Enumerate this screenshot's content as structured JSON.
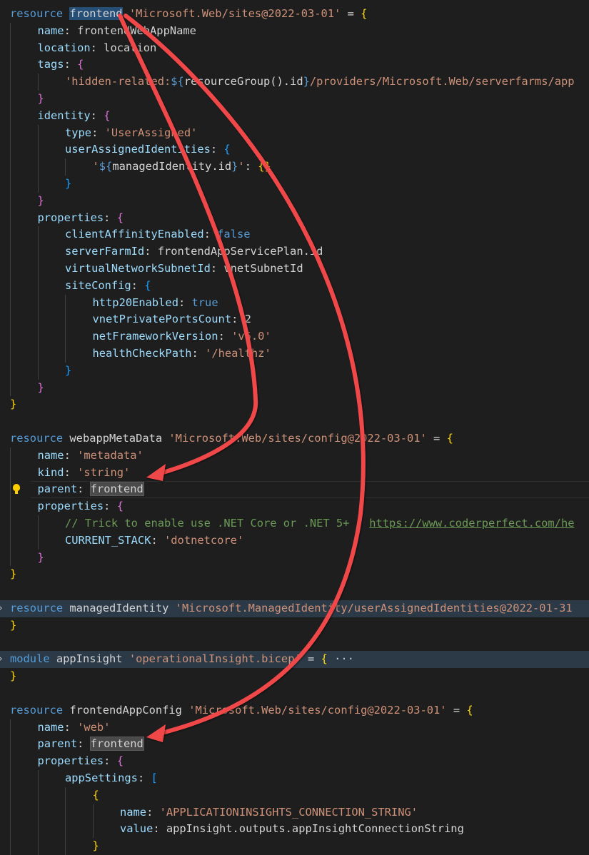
{
  "editor": {
    "lines": [
      {
        "segments": [
          {
            "t": "resource",
            "c": "k"
          },
          {
            "t": " "
          },
          {
            "t": "frontend",
            "c": "sel"
          },
          {
            "t": " "
          },
          {
            "t": "'Microsoft.Web/sites@2022-03-01'",
            "c": "s"
          },
          {
            "t": " = "
          },
          {
            "t": "{",
            "c": "b1"
          }
        ]
      },
      {
        "indent": 1,
        "segments": [
          {
            "t": "name",
            "c": "p"
          },
          {
            "t": ": frontendWebAppName"
          }
        ]
      },
      {
        "indent": 1,
        "segments": [
          {
            "t": "location",
            "c": "p"
          },
          {
            "t": ": location"
          }
        ]
      },
      {
        "indent": 1,
        "segments": [
          {
            "t": "tags",
            "c": "p"
          },
          {
            "t": ": "
          },
          {
            "t": "{",
            "c": "b2"
          }
        ]
      },
      {
        "indent": 2,
        "segments": [
          {
            "t": "'hidden-related:",
            "c": "s"
          },
          {
            "t": "${",
            "c": "k"
          },
          {
            "t": "resourceGroup().id"
          },
          {
            "t": "}",
            "c": "k"
          },
          {
            "t": "/providers/Microsoft.Web/serverfarms/app",
            "c": "s"
          }
        ]
      },
      {
        "indent": 1,
        "segments": [
          {
            "t": "}",
            "c": "b2"
          }
        ]
      },
      {
        "indent": 1,
        "segments": [
          {
            "t": "identity",
            "c": "p"
          },
          {
            "t": ": "
          },
          {
            "t": "{",
            "c": "b2"
          }
        ]
      },
      {
        "indent": 2,
        "segments": [
          {
            "t": "type",
            "c": "p"
          },
          {
            "t": ": "
          },
          {
            "t": "'UserAssigned'",
            "c": "s"
          }
        ]
      },
      {
        "indent": 2,
        "segments": [
          {
            "t": "userAssignedIdentities",
            "c": "p"
          },
          {
            "t": ": "
          },
          {
            "t": "{",
            "c": "b3"
          }
        ]
      },
      {
        "indent": 3,
        "segments": [
          {
            "t": "'",
            "c": "s"
          },
          {
            "t": "${",
            "c": "k"
          },
          {
            "t": "managedIdentity.id"
          },
          {
            "t": "}",
            "c": "k"
          },
          {
            "t": "'",
            "c": "s"
          },
          {
            "t": ": "
          },
          {
            "t": "{}",
            "c": "b1"
          }
        ]
      },
      {
        "indent": 2,
        "segments": [
          {
            "t": "}",
            "c": "b3"
          }
        ]
      },
      {
        "indent": 1,
        "segments": [
          {
            "t": "}",
            "c": "b2"
          }
        ]
      },
      {
        "indent": 1,
        "segments": [
          {
            "t": "properties",
            "c": "p"
          },
          {
            "t": ": "
          },
          {
            "t": "{",
            "c": "b2"
          }
        ]
      },
      {
        "indent": 2,
        "segments": [
          {
            "t": "clientAffinityEnabled",
            "c": "p"
          },
          {
            "t": ": "
          },
          {
            "t": "false",
            "c": "k"
          }
        ]
      },
      {
        "indent": 2,
        "segments": [
          {
            "t": "serverFarmId",
            "c": "p"
          },
          {
            "t": ": frontendAppServicePlan.id"
          }
        ]
      },
      {
        "indent": 2,
        "segments": [
          {
            "t": "virtualNetworkSubnetId",
            "c": "p"
          },
          {
            "t": ": vnetSubnetId"
          }
        ]
      },
      {
        "indent": 2,
        "segments": [
          {
            "t": "siteConfig",
            "c": "p"
          },
          {
            "t": ": "
          },
          {
            "t": "{",
            "c": "b3"
          }
        ]
      },
      {
        "indent": 3,
        "segments": [
          {
            "t": "http20Enabled",
            "c": "p"
          },
          {
            "t": ": "
          },
          {
            "t": "true",
            "c": "k"
          }
        ]
      },
      {
        "indent": 3,
        "segments": [
          {
            "t": "vnetPrivatePortsCount",
            "c": "p"
          },
          {
            "t": ": 2"
          }
        ]
      },
      {
        "indent": 3,
        "segments": [
          {
            "t": "netFrameworkVersion",
            "c": "p"
          },
          {
            "t": ": "
          },
          {
            "t": "'v6.0'",
            "c": "s"
          }
        ]
      },
      {
        "indent": 3,
        "segments": [
          {
            "t": "healthCheckPath",
            "c": "p"
          },
          {
            "t": ": "
          },
          {
            "t": "'/healthz'",
            "c": "s"
          }
        ]
      },
      {
        "indent": 2,
        "segments": [
          {
            "t": "}",
            "c": "b3"
          }
        ]
      },
      {
        "indent": 1,
        "segments": [
          {
            "t": "}",
            "c": "b2"
          }
        ]
      },
      {
        "segments": [
          {
            "t": "}",
            "c": "b1"
          }
        ]
      },
      {
        "segments": []
      },
      {
        "segments": [
          {
            "t": "resource",
            "c": "k"
          },
          {
            "t": " webappMetaData "
          },
          {
            "t": "'Microsoft.Web/sites/config@2022-03-01'",
            "c": "s"
          },
          {
            "t": " = "
          },
          {
            "t": "{",
            "c": "b1"
          }
        ]
      },
      {
        "indent": 1,
        "segments": [
          {
            "t": "name",
            "c": "p"
          },
          {
            "t": ": "
          },
          {
            "t": "'metadata'",
            "c": "s"
          }
        ]
      },
      {
        "indent": 1,
        "segments": [
          {
            "t": "kind",
            "c": "p"
          },
          {
            "t": ": "
          },
          {
            "t": "'string'",
            "c": "s"
          }
        ]
      },
      {
        "indent": 1,
        "cursor": true,
        "bulb": true,
        "segments": [
          {
            "t": "parent",
            "c": "p"
          },
          {
            "t": ": "
          },
          {
            "t": "frontend",
            "c": "hl"
          }
        ]
      },
      {
        "indent": 1,
        "segments": [
          {
            "t": "properties",
            "c": "p"
          },
          {
            "t": ": "
          },
          {
            "t": "{",
            "c": "b2"
          }
        ]
      },
      {
        "indent": 2,
        "segments": [
          {
            "t": "// Trick to enable use .NET Core or .NET 5+ : ",
            "c": "c"
          },
          {
            "t": "https://www.coderperfect.com/he",
            "c": "u"
          }
        ]
      },
      {
        "indent": 2,
        "segments": [
          {
            "t": "CURRENT_STACK",
            "c": "p"
          },
          {
            "t": ": "
          },
          {
            "t": "'dotnetcore'",
            "c": "s"
          }
        ]
      },
      {
        "indent": 1,
        "segments": [
          {
            "t": "}",
            "c": "b2"
          }
        ]
      },
      {
        "segments": [
          {
            "t": "}",
            "c": "b1"
          }
        ]
      },
      {
        "segments": []
      },
      {
        "folded": true,
        "segments": [
          {
            "t": "resource",
            "c": "k"
          },
          {
            "t": " managedIdentity "
          },
          {
            "t": "'Microsoft.ManagedIdentity/userAssignedIdentities@2022-01-31",
            "c": "s"
          }
        ]
      },
      {
        "segments": [
          {
            "t": "}",
            "c": "b1"
          }
        ]
      },
      {
        "segments": []
      },
      {
        "folded": true,
        "segments": [
          {
            "t": "module",
            "c": "k"
          },
          {
            "t": " appInsight "
          },
          {
            "t": "'operationalInsight.bicep'",
            "c": "s"
          },
          {
            "t": " = "
          },
          {
            "t": "{",
            "c": "b1"
          },
          {
            "t": " ···",
            "c": "ell"
          }
        ]
      },
      {
        "segments": [
          {
            "t": "}",
            "c": "b1"
          }
        ]
      },
      {
        "segments": []
      },
      {
        "segments": [
          {
            "t": "resource",
            "c": "k"
          },
          {
            "t": " frontendAppConfig "
          },
          {
            "t": "'Microsoft.Web/sites/config@2022-03-01'",
            "c": "s"
          },
          {
            "t": " = "
          },
          {
            "t": "{",
            "c": "b1"
          }
        ]
      },
      {
        "indent": 1,
        "segments": [
          {
            "t": "name",
            "c": "p"
          },
          {
            "t": ": "
          },
          {
            "t": "'web'",
            "c": "s"
          }
        ]
      },
      {
        "indent": 1,
        "segments": [
          {
            "t": "parent",
            "c": "p"
          },
          {
            "t": ": "
          },
          {
            "t": "frontend",
            "c": "hl"
          }
        ]
      },
      {
        "indent": 1,
        "segments": [
          {
            "t": "properties",
            "c": "p"
          },
          {
            "t": ": "
          },
          {
            "t": "{",
            "c": "b2"
          }
        ]
      },
      {
        "indent": 2,
        "segments": [
          {
            "t": "appSettings",
            "c": "p"
          },
          {
            "t": ": "
          },
          {
            "t": "[",
            "c": "b3"
          }
        ]
      },
      {
        "indent": 3,
        "segments": [
          {
            "t": "{",
            "c": "b1"
          }
        ]
      },
      {
        "indent": 4,
        "segments": [
          {
            "t": "name",
            "c": "p"
          },
          {
            "t": ": "
          },
          {
            "t": "'APPLICATIONINSIGHTS_CONNECTION_STRING'",
            "c": "s"
          }
        ]
      },
      {
        "indent": 4,
        "segments": [
          {
            "t": "value",
            "c": "p"
          },
          {
            "t": ": appInsight.outputs.appInsightConnectionString"
          }
        ]
      },
      {
        "indent": 3,
        "segments": [
          {
            "t": "}",
            "c": "b1"
          }
        ]
      }
    ]
  },
  "colors": {
    "background": "#1e1e1e",
    "keyword": "#569cd6",
    "property": "#9cdcfe",
    "string": "#ce9178",
    "comment": "#6a9955",
    "arrow": "#f0474a"
  },
  "icons": [
    "lightbulb-icon",
    "fold-chevron-icon"
  ]
}
